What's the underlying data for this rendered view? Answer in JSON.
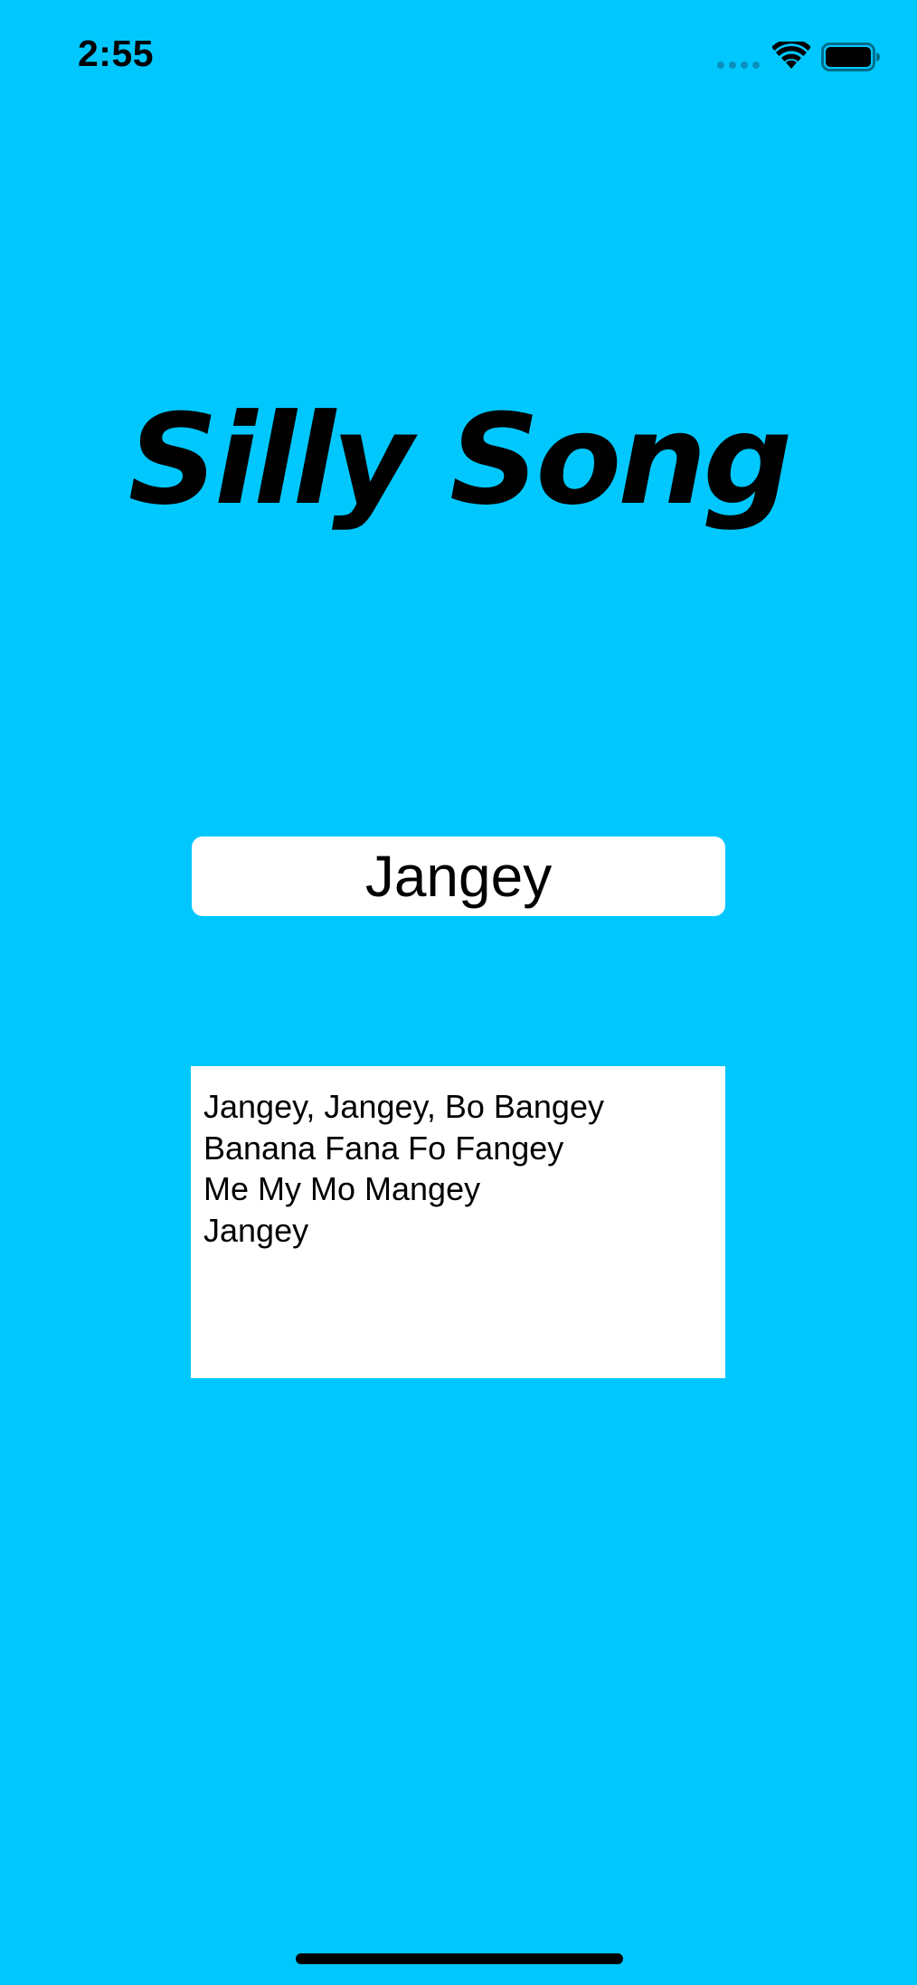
{
  "status_bar": {
    "time": "2:55",
    "icons": [
      "signal-dots-icon",
      "wifi-icon",
      "battery-icon"
    ]
  },
  "title": "Silly Song",
  "name_field": {
    "value": "Jangey"
  },
  "lyrics": {
    "lines": [
      "Jangey, Jangey, Bo Bangey",
      "Banana Fana Fo Fangey",
      "Me My Mo Mangey",
      "Jangey"
    ]
  },
  "colors": {
    "background": "#00c8ff",
    "field_background": "#ffffff",
    "text": "#000000"
  }
}
